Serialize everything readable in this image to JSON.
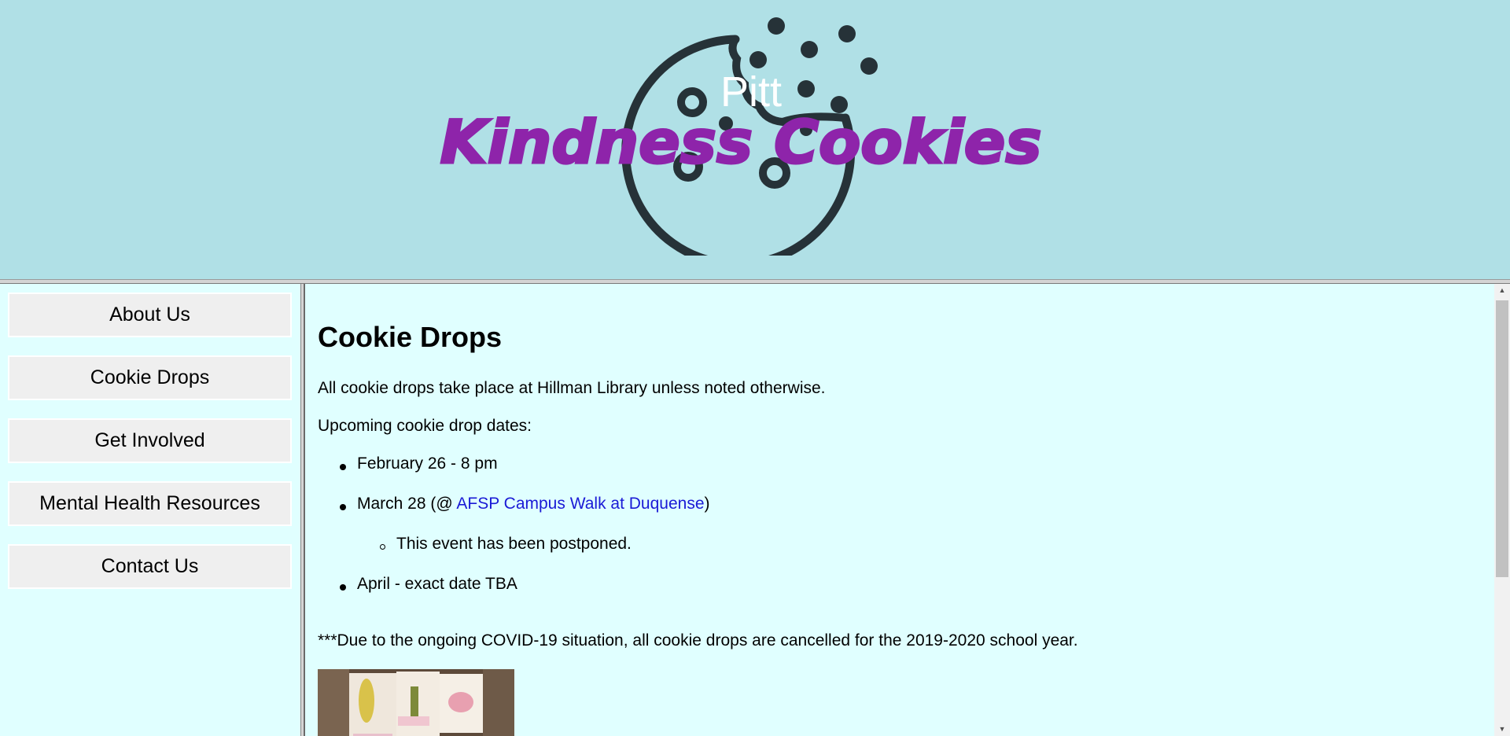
{
  "header": {
    "logo": {
      "small_text": "Pitt",
      "main_text": "Kindness Cookies",
      "main_color": "#8e24aa",
      "cookie_color": "#263238"
    }
  },
  "sidebar": {
    "items": [
      {
        "label": "About Us"
      },
      {
        "label": "Cookie Drops"
      },
      {
        "label": "Get Involved"
      },
      {
        "label": "Mental Health Resources"
      },
      {
        "label": "Contact Us"
      }
    ]
  },
  "main": {
    "title": "Cookie Drops",
    "intro": "All cookie drops take place at Hillman Library unless noted otherwise.",
    "upcoming_label": "Upcoming cookie drop dates:",
    "dates": {
      "item1": "February 26 - 8 pm",
      "item2_prefix": "March 28 (@ ",
      "item2_link": "AFSP Campus Walk at Duquense",
      "item2_suffix": ")",
      "item2_sub": "This event has been postponed.",
      "item3": "April - exact date TBA"
    },
    "notice": "***Due to the ongoing COVID-19 situation, all cookie drops are cancelled for the 2019-2020 school year."
  },
  "colors": {
    "header_bg": "#b0e0e6",
    "page_bg": "#e0ffff",
    "button_bg": "#efefef",
    "link": "#1a1ad6"
  }
}
